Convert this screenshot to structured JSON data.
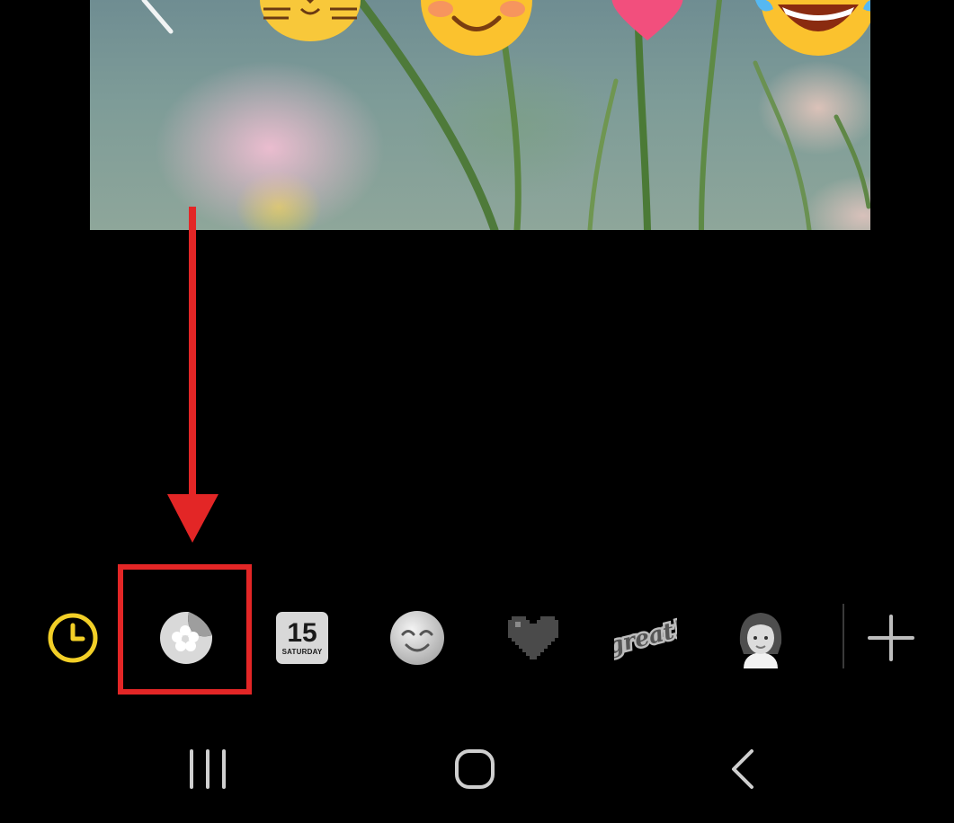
{
  "toolbar": {
    "recent_icon": "clock-icon",
    "selected_icon": "sticker-pack-icon",
    "calendar_day": "15",
    "calendar_weekday": "SATURDAY",
    "sticker_text": "great!",
    "add_icon": "plus-icon"
  },
  "navbar": {
    "recents_icon": "recent-apps-icon",
    "home_icon": "home-icon",
    "back_icon": "back-icon"
  },
  "colors": {
    "accent": "#f2cf27",
    "highlight": "#e32626",
    "background": "#000000"
  }
}
